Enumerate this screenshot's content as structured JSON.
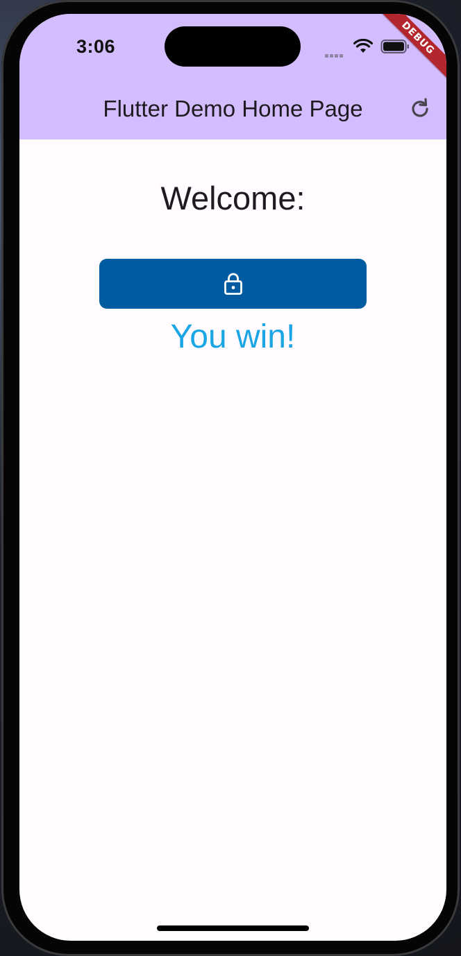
{
  "status_bar": {
    "time": "3:06"
  },
  "app_bar": {
    "title": "Flutter Demo Home Page",
    "background_color": "#d4bdff",
    "action_icon": "refresh-icon"
  },
  "debug_banner": {
    "label": "DEBUG",
    "color": "#b3262d"
  },
  "body": {
    "welcome_text": "Welcome:",
    "lock_button": {
      "icon": "lock-icon",
      "color": "#005ba0"
    },
    "result_text": "You win!",
    "result_color": "#1aa6e4"
  }
}
